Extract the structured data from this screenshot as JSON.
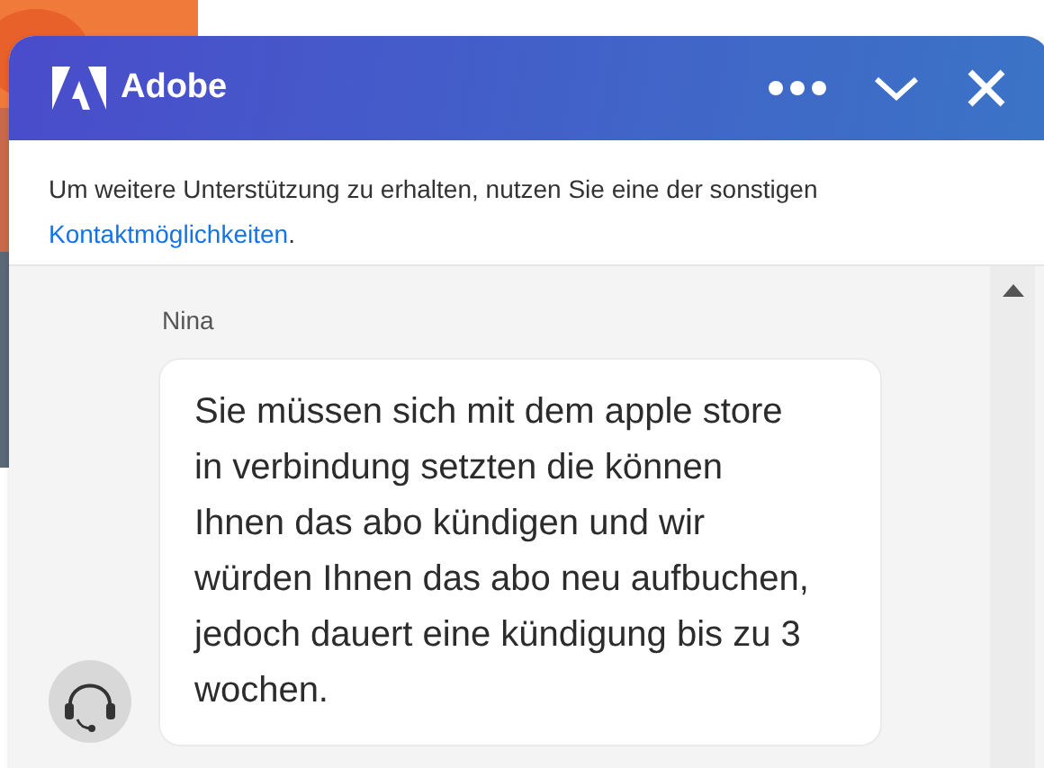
{
  "header": {
    "brand": "Adobe"
  },
  "notice": {
    "text": "Um weitere Unterstützung zu erhalten, nutzen Sie eine der sonstigen",
    "link": "Kontaktmöglichkeiten",
    "suffix": "."
  },
  "messages": [
    {
      "sender": "Nina",
      "text": "Sie müssen sich mit dem apple store in verbindung setzten die können Ihnen das abo kündigen und wir würden Ihnen das abo neu aufbuchen, jedoch dauert eine kündigung bis zu 3 wochen."
    }
  ]
}
